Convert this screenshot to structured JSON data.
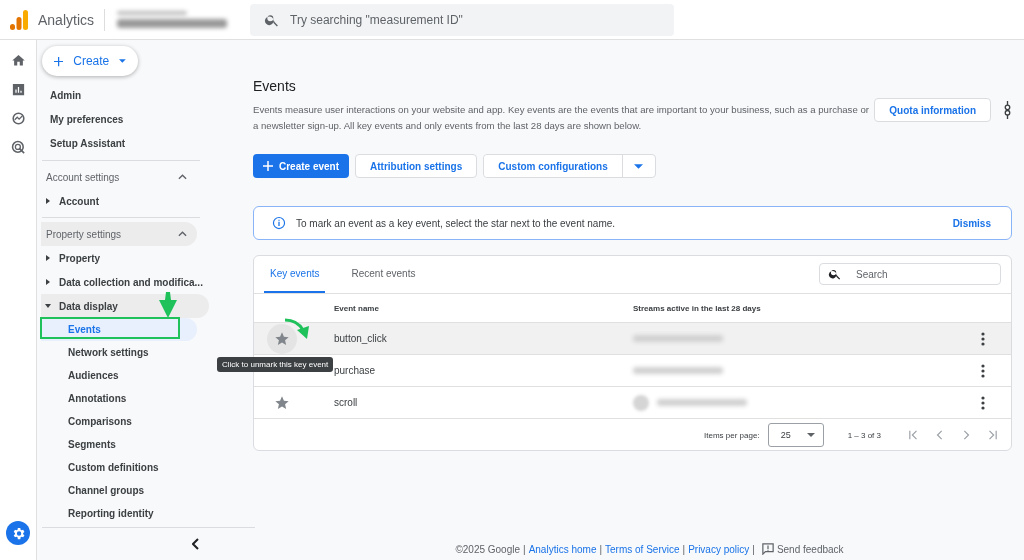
{
  "header": {
    "product": "Analytics",
    "search_placeholder": "Try searching \"measurement ID\""
  },
  "sidebar": {
    "create_button": "Create",
    "links": [
      "Admin",
      "My preferences",
      "Setup Assistant"
    ],
    "sections": [
      {
        "title": "Account settings",
        "expanded": true,
        "highlighted": false,
        "items": [
          {
            "label": "Account",
            "expanded": false,
            "highlighted": false
          }
        ]
      },
      {
        "title": "Property settings",
        "expanded": true,
        "highlighted": true,
        "items": [
          {
            "label": "Property",
            "expanded": false,
            "highlighted": false
          },
          {
            "label": "Data collection and modifica...",
            "expanded": false,
            "highlighted": false
          },
          {
            "label": "Data display",
            "expanded": true,
            "highlighted": true,
            "children": [
              {
                "label": "Events",
                "selected": true
              },
              {
                "label": "Network settings",
                "selected": false
              },
              {
                "label": "Audiences",
                "selected": false
              },
              {
                "label": "Annotations",
                "selected": false
              },
              {
                "label": "Comparisons",
                "selected": false
              },
              {
                "label": "Segments",
                "selected": false
              },
              {
                "label": "Custom definitions",
                "selected": false
              },
              {
                "label": "Channel groups",
                "selected": false
              },
              {
                "label": "Reporting identity",
                "selected": false
              }
            ]
          }
        ]
      }
    ]
  },
  "page": {
    "title": "Events",
    "description": "Events measure user interactions on your website and app. Key events are the events that are important to your business, such as a purchase or a newsletter sign-up. All key events and only events from the last 28 days are shown below.",
    "quota_button": "Quota information",
    "create_button": "Create event",
    "attribution_button": "Attribution settings",
    "custom_button": "Custom configurations",
    "banner": {
      "text": "To mark an event as a key event, select the star next to the event name.",
      "dismiss": "Dismiss"
    }
  },
  "table": {
    "tabs": [
      {
        "label": "Key events",
        "selected": true
      },
      {
        "label": "Recent events",
        "selected": false
      }
    ],
    "search_placeholder": "Search",
    "columns": [
      "Event name",
      "Streams active in the last 28 days"
    ],
    "rows": [
      {
        "name": "button_click",
        "highlighted": true
      },
      {
        "name": "purchase",
        "highlighted": false
      },
      {
        "name": "scroll",
        "highlighted": false
      }
    ],
    "tooltip": "Click to unmark this key event",
    "items_per_page_label": "Items per page:",
    "items_per_page": "25",
    "range": "1 – 3 of 3"
  },
  "footer": {
    "copyright": "©2025 Google",
    "separator": "|",
    "links": [
      "Analytics home",
      "Terms of Service",
      "Privacy policy"
    ],
    "feedback": "Send feedback"
  }
}
